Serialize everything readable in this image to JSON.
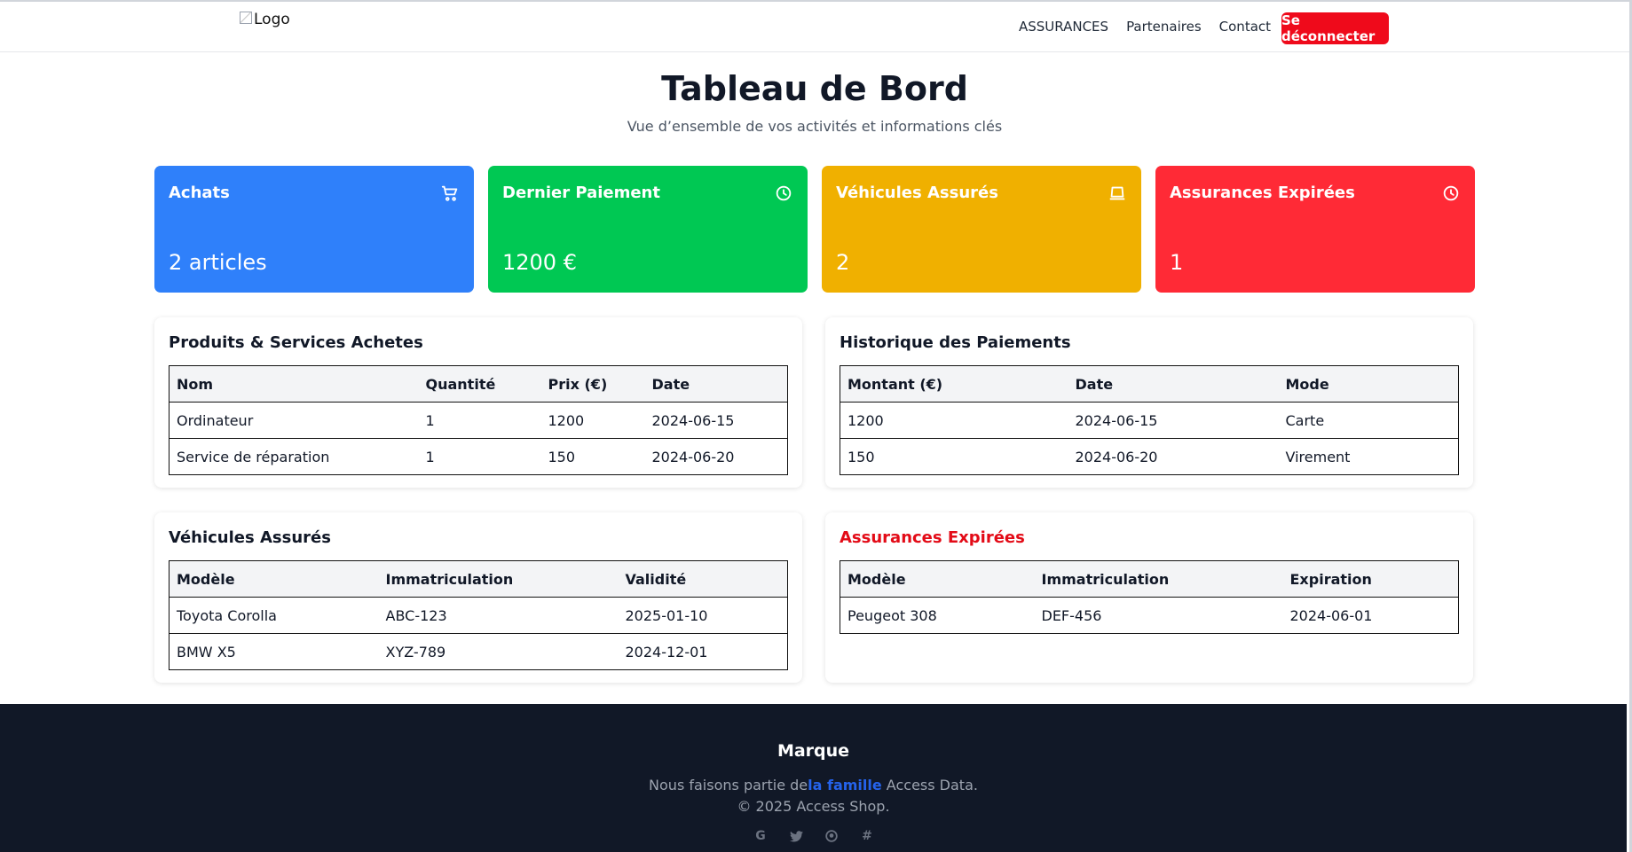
{
  "header": {
    "logo_alt": "Logo",
    "nav": [
      "ASSURANCES",
      "Partenaires",
      "Contact"
    ],
    "logout_label": "Se déconnecter"
  },
  "page": {
    "title": "Tableau de Bord",
    "subtitle": "Vue d’ensemble de vos activités et informations clés"
  },
  "stats": [
    {
      "title": "Achats",
      "value": "2 articles",
      "color": "#2f80fa",
      "icon": "cart-icon"
    },
    {
      "title": "Dernier Paiement",
      "value": "1200 €",
      "color": "#00c853",
      "icon": "clock-icon"
    },
    {
      "title": "Véhicules Assurés",
      "value": "2",
      "color": "#f0b000",
      "icon": "car-icon"
    },
    {
      "title": "Assurances Expirées",
      "value": "1",
      "color": "#ff2a36",
      "icon": "clock-icon"
    }
  ],
  "products": {
    "title": "Produits & Services Achetes",
    "columns": [
      "Nom",
      "Quantité",
      "Prix (€)",
      "Date"
    ],
    "rows": [
      [
        "Ordinateur",
        "1",
        "1200",
        "2024-06-15"
      ],
      [
        "Service de réparation",
        "1",
        "150",
        "2024-06-20"
      ]
    ]
  },
  "payments": {
    "title": "Historique des Paiements",
    "columns": [
      "Montant (€)",
      "Date",
      "Mode"
    ],
    "rows": [
      [
        "1200",
        "2024-06-15",
        "Carte"
      ],
      [
        "150",
        "2024-06-20",
        "Virement"
      ]
    ]
  },
  "vehicles": {
    "title": "Véhicules Assurés",
    "columns": [
      "Modèle",
      "Immatriculation",
      "Validité"
    ],
    "rows": [
      [
        "Toyota Corolla",
        "ABC-123",
        "2025-01-10"
      ],
      [
        "BMW X5",
        "XYZ-789",
        "2024-12-01"
      ]
    ]
  },
  "expired": {
    "title": "Assurances Expirées",
    "title_color": "#e30b17",
    "columns": [
      "Modèle",
      "Immatriculation",
      "Expiration"
    ],
    "rows": [
      [
        "Peugeot 308",
        "DEF-456",
        "2024-06-01"
      ]
    ]
  },
  "footer": {
    "brand": "Marque",
    "line1_prefix": "Nous faisons partie de",
    "line1_link": "la famille",
    "line1_suffix": " Access Data.",
    "line2": "© 2025 Access Shop.",
    "social_icons": [
      "google-icon",
      "twitter-icon",
      "github-icon",
      "slack-icon"
    ]
  }
}
